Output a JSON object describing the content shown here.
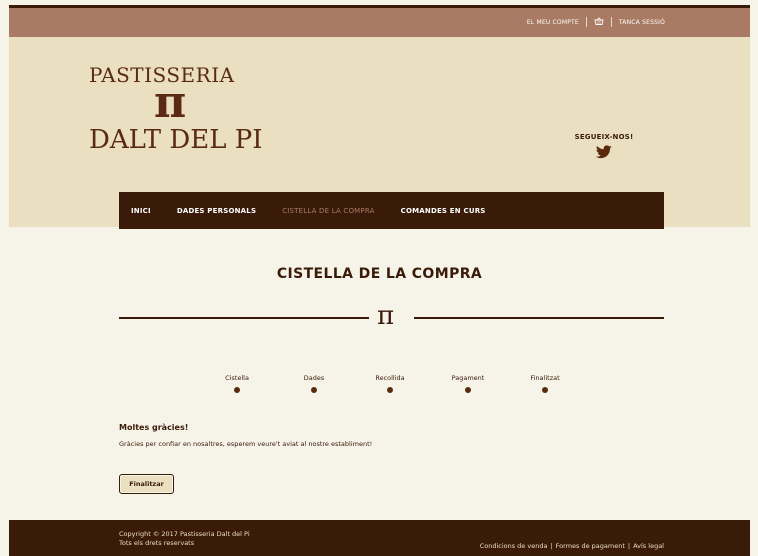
{
  "topbar": {
    "account_label": "EL MEU COMPTE",
    "logout_label": "TANCA SESSIÓ"
  },
  "logo": {
    "line1": "PASTISSERIA",
    "symbol": "π",
    "line2": "DALT DEL PI"
  },
  "social": {
    "follow_label": "SEGUEIX-NOS!",
    "icon": "twitter-icon"
  },
  "nav": {
    "items": [
      {
        "label": "INICI",
        "active": false
      },
      {
        "label": "DADES PERSONALS",
        "active": false
      },
      {
        "label": "CISTELLA DE LA COMPRA",
        "active": true
      },
      {
        "label": "COMANDES EN CURS",
        "active": false
      }
    ]
  },
  "main": {
    "title": "CISTELLA DE LA COMPRA",
    "divider_symbol": "π",
    "steps": [
      "Cistella",
      "Dades",
      "Recollida",
      "Pagament",
      "Finalitzat"
    ],
    "thanks_title": "Moltes gràcies!",
    "thanks_text": "Gràcies per confiar en nosaltres, esperem veure't aviat al nostre establiment!",
    "finish_button": "Finalitzar"
  },
  "footer": {
    "copyright_line1": "Copyright © 2017 Pastisseria Dalt del Pi",
    "copyright_line2": "Tots els drets reservats",
    "links": [
      "Condicions de venda",
      "Formes de pagament",
      "Avís legal"
    ]
  },
  "colors": {
    "dark_brown": "#3a1a08",
    "topbar": "#a97b64",
    "header_bg": "#eadfc1",
    "page_bg": "#f6f4e9"
  }
}
